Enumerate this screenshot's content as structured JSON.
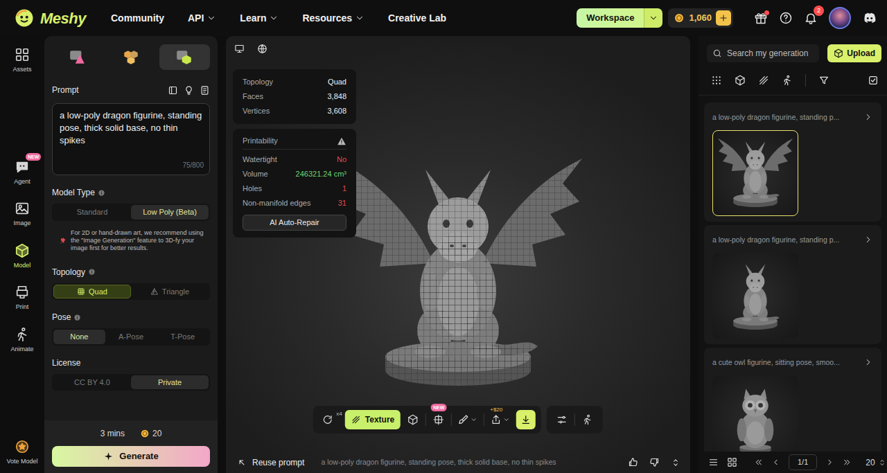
{
  "topbar": {
    "logo": "Meshy",
    "nav": [
      {
        "label": "Community",
        "dropdown": false
      },
      {
        "label": "API",
        "dropdown": true
      },
      {
        "label": "Learn",
        "dropdown": true
      },
      {
        "label": "Resources",
        "dropdown": true
      },
      {
        "label": "Creative Lab",
        "dropdown": false
      }
    ],
    "workspace": "Workspace",
    "credits": "1,060",
    "gift_unread": true,
    "notifications": "2"
  },
  "sidebar": {
    "top_items": [
      {
        "label": "Assets",
        "selected": false
      }
    ],
    "tool_items": [
      {
        "label": "Agent",
        "selected": false,
        "badge": "NEW"
      },
      {
        "label": "Image",
        "selected": false
      },
      {
        "label": "Model",
        "selected": true
      },
      {
        "label": "Print",
        "selected": false
      },
      {
        "label": "Animate",
        "selected": false
      }
    ],
    "footer_item": {
      "label": "Vote Model"
    }
  },
  "generator": {
    "modes": [
      {
        "selected": false
      },
      {
        "selected": false
      },
      {
        "selected": true
      }
    ],
    "prompt": {
      "label": "Prompt",
      "value": "a low-poly dragon figurine, standing pose, thick solid base, no thin spikes",
      "counter": "75/800"
    },
    "model_type": {
      "label": "Model Type",
      "options": [
        {
          "label": "Standard",
          "selected": false
        },
        {
          "label": "Low Poly (Beta)",
          "selected": true
        }
      ]
    },
    "note": "For 2D or hand-drawn art, we recommend using the \"Image Generation\" feature to 3D-fy your image first for better results.",
    "topology": {
      "label": "Topology",
      "options": [
        {
          "label": "Quad",
          "selected": true
        },
        {
          "label": "Triangle",
          "selected": false
        }
      ]
    },
    "pose": {
      "label": "Pose",
      "options": [
        {
          "label": "None",
          "selected": true
        },
        {
          "label": "A-Pose",
          "selected": false
        },
        {
          "label": "T-Pose",
          "selected": false
        }
      ]
    },
    "license": {
      "label": "License",
      "options": [
        {
          "label": "CC BY 4.0",
          "selected": false
        },
        {
          "label": "Private",
          "selected": true
        }
      ]
    },
    "time": "3 mins",
    "cost": "20",
    "generate": "Generate"
  },
  "viewer": {
    "stats": [
      {
        "label": "Topology",
        "value": "Quad"
      },
      {
        "label": "Faces",
        "value": "3,848"
      },
      {
        "label": "Vertices",
        "value": "3,608"
      }
    ],
    "printability": {
      "title": "Printability",
      "rows": [
        {
          "label": "Watertight",
          "value": "No",
          "color": "#e5484d"
        },
        {
          "label": "Volume",
          "value": "246321.24 cm³",
          "color": "#6fd36f"
        },
        {
          "label": "Holes",
          "value": "1",
          "color": "#e5484d"
        },
        {
          "label": "Non-manifold edges",
          "value": "31",
          "color": "#e5484d"
        }
      ],
      "repair": "AI Auto-Repair"
    },
    "toolbar": {
      "retries": "x4",
      "texture": "Texture",
      "texture_selected": true,
      "new_badge": "NEW",
      "price": "+$20"
    },
    "reuse": "Reuse prompt",
    "prompt": "a low-poly dragon figurine, standing pose, thick solid base, no thin spikes"
  },
  "library": {
    "search_placeholder": "Search my generation",
    "upload": "Upload",
    "generations": [
      {
        "title": "a low-poly dragon figurine, standing p...",
        "selected": true,
        "kind": "winged-dragon"
      },
      {
        "title": "a low-poly dragon figurine, standing p...",
        "selected": false,
        "kind": "dragon"
      },
      {
        "title": "a cute owl figurine, sitting pose, smoo...",
        "selected": false,
        "kind": "owl"
      }
    ],
    "pagination": {
      "page": "1/1",
      "per_page": "20"
    }
  }
}
